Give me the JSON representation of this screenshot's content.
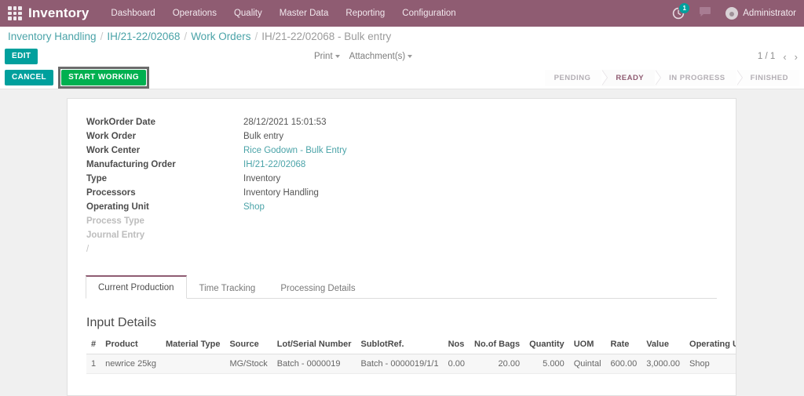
{
  "navbar": {
    "apps_icon": "apps-grid-icon",
    "brand": "Inventory",
    "menu": [
      {
        "label": "Dashboard"
      },
      {
        "label": "Operations"
      },
      {
        "label": "Quality"
      },
      {
        "label": "Master Data"
      },
      {
        "label": "Reporting"
      },
      {
        "label": "Configuration"
      }
    ],
    "activity_icon": "activity-clock-icon",
    "activity_count": "1",
    "messages_icon": "chat-bubble-icon",
    "avatar_icon": "user-avatar-icon",
    "user_name": "Administrator",
    "bg_color": "#8f5c72"
  },
  "breadcrumb": {
    "items": [
      {
        "label": "Inventory Handling",
        "link": true
      },
      {
        "label": "IH/21-22/02068",
        "link": true
      },
      {
        "label": "Work Orders",
        "link": true
      },
      {
        "label": "IH/21-22/02068 - Bulk entry",
        "link": false
      }
    ],
    "separator": "/",
    "link_color": "#4aa3a8"
  },
  "control_bar": {
    "edit_label": "EDIT",
    "print_label": "Print",
    "attachments_label": "Attachment(s)",
    "pager_text": "1 / 1",
    "prev_icon": "chevron-left-icon",
    "next_icon": "chevron-right-icon"
  },
  "action_bar": {
    "cancel_label": "CANCEL",
    "start_working_label": "START WORKING",
    "cancel_color": "#00A09D",
    "start_working_color": "#00b050",
    "focused_button": "start-working-button"
  },
  "statusbar": {
    "steps": [
      {
        "label": "PENDING",
        "active": false
      },
      {
        "label": "READY",
        "active": true
      },
      {
        "label": "IN PROGRESS",
        "active": false
      },
      {
        "label": "FINISHED",
        "active": false
      }
    ],
    "active_color": "#8f5c72"
  },
  "form": {
    "fields": [
      {
        "label": "WorkOrder Date",
        "value": "28/12/2021 15:01:53",
        "link": false,
        "muted": false
      },
      {
        "label": "Work Order",
        "value": "Bulk entry",
        "link": false,
        "muted": false
      },
      {
        "label": "Work Center",
        "value": "Rice Godown - Bulk Entry",
        "link": true,
        "muted": false
      },
      {
        "label": "Manufacturing Order",
        "value": "IH/21-22/02068",
        "link": true,
        "muted": false
      },
      {
        "label": "Type",
        "value": "Inventory",
        "link": false,
        "muted": false
      },
      {
        "label": "Processors",
        "value": "Inventory Handling",
        "link": false,
        "muted": false
      },
      {
        "label": "Operating Unit",
        "value": "Shop",
        "link": true,
        "muted": false
      },
      {
        "label": "Process Type",
        "value": "",
        "link": false,
        "muted": true
      },
      {
        "label": "Journal Entry",
        "value": "",
        "link": false,
        "muted": true
      }
    ],
    "trailing_slash": "/"
  },
  "tabs": [
    {
      "label": "Current Production",
      "active": true
    },
    {
      "label": "Time Tracking",
      "active": false
    },
    {
      "label": "Processing Details",
      "active": false
    }
  ],
  "input_details": {
    "title": "Input Details",
    "columns": [
      {
        "label": "#",
        "align": "left"
      },
      {
        "label": "Product",
        "align": "left"
      },
      {
        "label": "Material Type",
        "align": "left"
      },
      {
        "label": "Source",
        "align": "left"
      },
      {
        "label": "Lot/Serial Number",
        "align": "left"
      },
      {
        "label": "SublotRef.",
        "align": "left"
      },
      {
        "label": "Nos",
        "align": "right"
      },
      {
        "label": "No.of Bags",
        "align": "right"
      },
      {
        "label": "Quantity",
        "align": "right"
      },
      {
        "label": "UOM",
        "align": "left"
      },
      {
        "label": "Rate",
        "align": "right"
      },
      {
        "label": "Value",
        "align": "right"
      },
      {
        "label": "Operating Unit",
        "align": "left"
      }
    ],
    "rows": [
      {
        "index": "1",
        "product": "newrice 25kg",
        "material_type": "",
        "source": "MG/Stock",
        "lot_serial_number": "Batch - 0000019",
        "sublot_ref": "Batch - 0000019/1/1",
        "nos": "0.00",
        "no_of_bags": "20.00",
        "quantity": "5.000",
        "uom": "Quintal",
        "rate": "600.00",
        "value": "3,000.00",
        "operating_unit": "Shop"
      }
    ]
  }
}
